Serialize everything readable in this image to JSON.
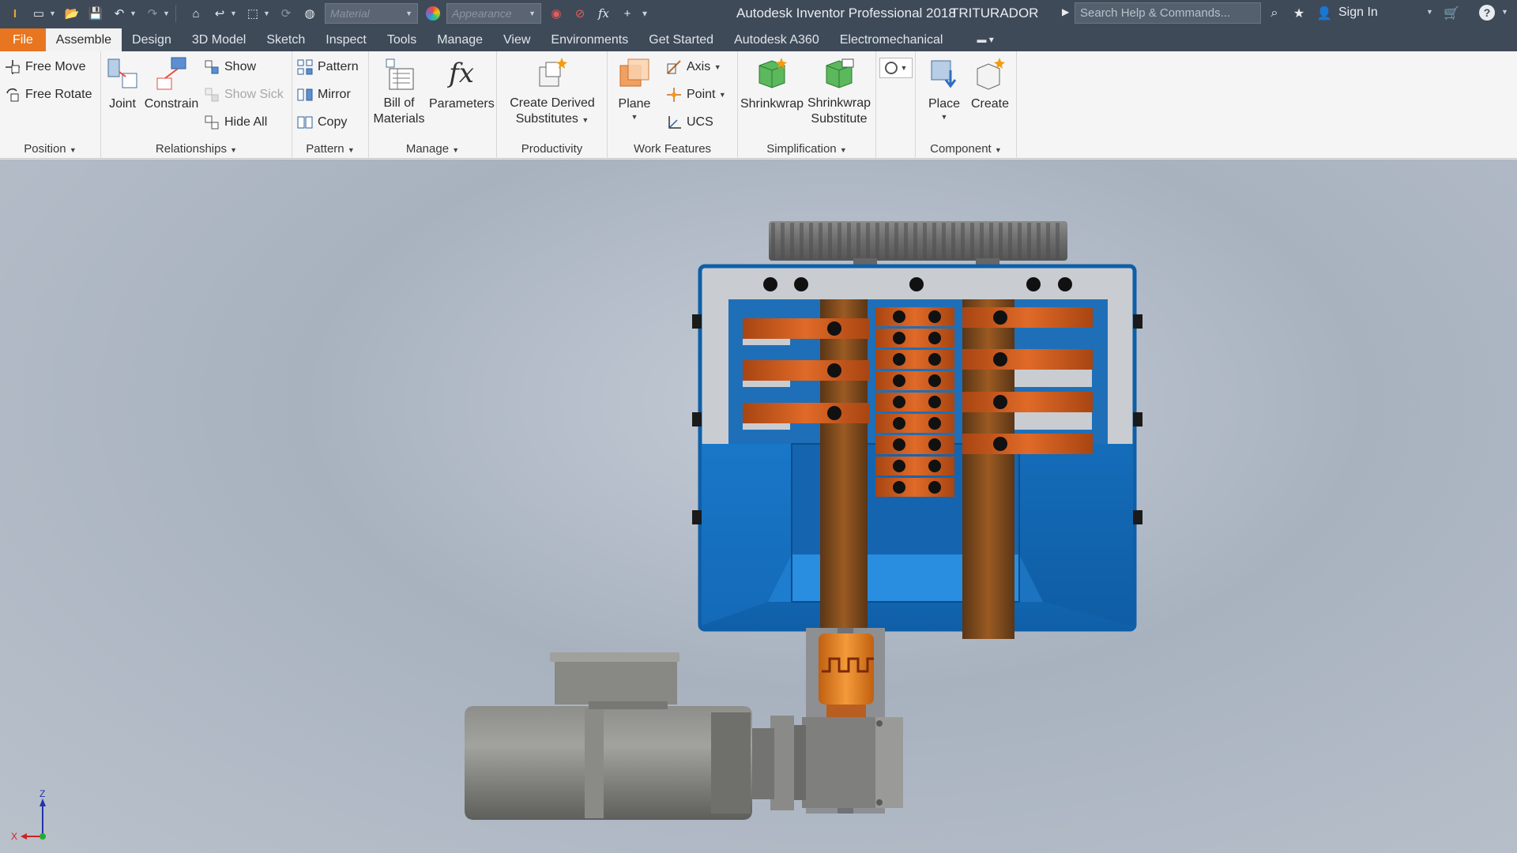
{
  "titlebar": {
    "app_title": "Autodesk Inventor Professional 2018",
    "document_name": "TRITURADOR",
    "material_placeholder": "Material",
    "appearance_placeholder": "Appearance",
    "search_placeholder": "Search Help & Commands...",
    "sign_in": "Sign In"
  },
  "tabs": [
    {
      "label": "File"
    },
    {
      "label": "Assemble"
    },
    {
      "label": "Design"
    },
    {
      "label": "3D Model"
    },
    {
      "label": "Sketch"
    },
    {
      "label": "Inspect"
    },
    {
      "label": "Tools"
    },
    {
      "label": "Manage"
    },
    {
      "label": "View"
    },
    {
      "label": "Environments"
    },
    {
      "label": "Get Started"
    },
    {
      "label": "Autodesk A360"
    },
    {
      "label": "Electromechanical"
    }
  ],
  "active_tab": "Assemble",
  "ribbon": {
    "position": {
      "title": "Position",
      "free_move": "Free Move",
      "free_rotate": "Free Rotate"
    },
    "relationships": {
      "title": "Relationships",
      "joint": "Joint",
      "constrain": "Constrain",
      "show": "Show",
      "show_sick": "Show Sick",
      "hide_all": "Hide All"
    },
    "pattern": {
      "title": "Pattern",
      "pattern": "Pattern",
      "mirror": "Mirror",
      "copy": "Copy"
    },
    "manage": {
      "title": "Manage",
      "bom_line1": "Bill of",
      "bom_line2": "Materials",
      "parameters": "Parameters"
    },
    "productivity": {
      "title": "Productivity",
      "create_derived_line1": "Create Derived",
      "create_derived_line2": "Substitutes"
    },
    "work_features": {
      "title": "Work Features",
      "plane": "Plane",
      "axis": "Axis",
      "point": "Point",
      "ucs": "UCS"
    },
    "simplification": {
      "title": "Simplification",
      "shrinkwrap": "Shrinkwrap",
      "shrinkwrap_sub_line1": "Shrinkwrap",
      "shrinkwrap_sub_line2": "Substitute"
    },
    "component": {
      "title": "Component",
      "place": "Place",
      "create": "Create"
    }
  },
  "viewcube": {
    "axis_z": "Z",
    "axis_x": "X"
  },
  "colors": {
    "accent_orange": "#e8751f",
    "titlebar_bg": "#3f4a59",
    "housing_blue": "#1b78c8",
    "blade_copper": "#c9581c"
  }
}
